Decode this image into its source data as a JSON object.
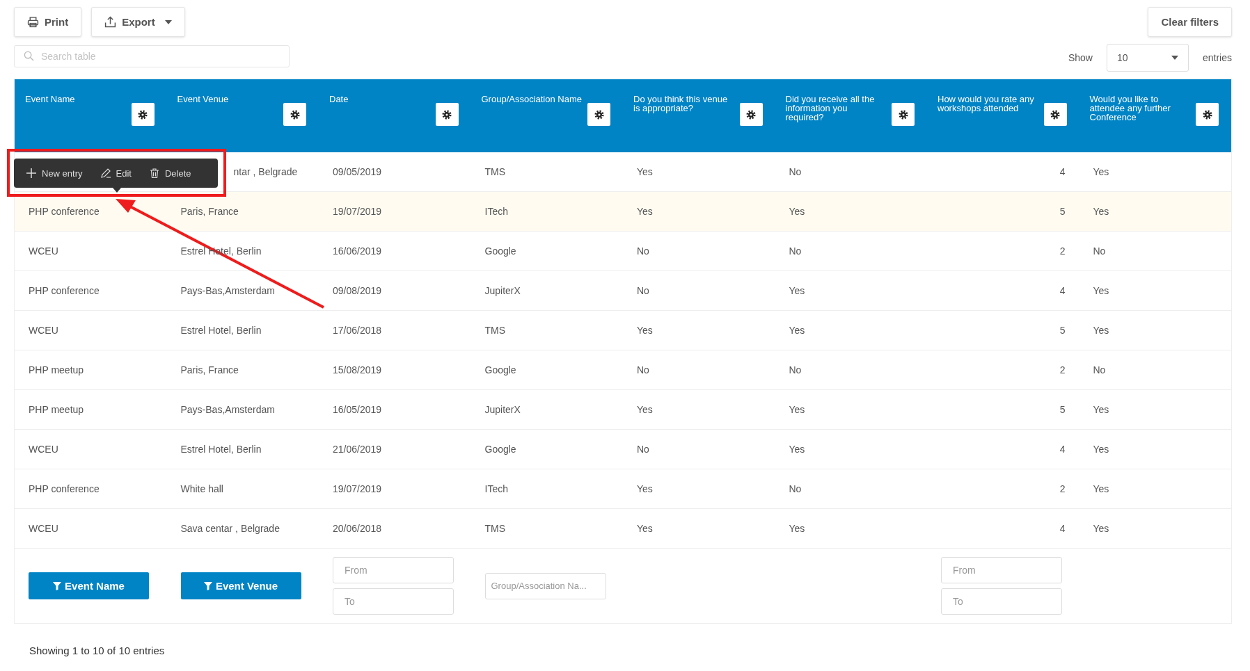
{
  "toolbar": {
    "buttons": [
      {
        "label": "Print",
        "kind": "print"
      },
      {
        "label": "Export",
        "kind": "export"
      }
    ],
    "clear_filters": "Clear filters"
  },
  "search": {
    "placeholder": "Search table"
  },
  "page_size": {
    "label": "Show",
    "value": "10",
    "suffix": "entries"
  },
  "table": {
    "columns": [
      "Event Name",
      "Event Venue",
      "Date",
      "Group/Association Name",
      "Do you think this venue is appropriate?",
      "Did you receive all the information you required?",
      "How would you rate any workshops attended",
      "Would you like to attendee any further Conference"
    ],
    "rows": [
      {
        "venue": "ntar , Belgrade",
        "date": "09/05/2019",
        "group": "TMS",
        "appropriate": "Yes",
        "informed": "No",
        "rating": "4",
        "attend": "Yes",
        "highlighted": false
      },
      {
        "event": "PHP conference",
        "venue": "Paris, France",
        "date": "19/07/2019",
        "group": "ITech",
        "appropriate": "Yes",
        "informed": "Yes",
        "rating": "5",
        "attend": "Yes",
        "highlighted": true
      },
      {
        "event": "WCEU",
        "venue": "Estrel Hotel, Berlin",
        "date": "16/06/2019",
        "group": "Google",
        "appropriate": "No",
        "informed": "No",
        "rating": "2",
        "attend": "No",
        "highlighted": false
      },
      {
        "event": "PHP conference",
        "venue": "Pays-Bas,Amsterdam",
        "date": "09/08/2019",
        "group": "JupiterX",
        "appropriate": "No",
        "informed": "Yes",
        "rating": "4",
        "attend": "Yes",
        "highlighted": false
      },
      {
        "event": "WCEU",
        "venue": "Estrel Hotel, Berlin",
        "date": "17/06/2018",
        "group": "TMS",
        "appropriate": "Yes",
        "informed": "Yes",
        "rating": "5",
        "attend": "Yes",
        "highlighted": false
      },
      {
        "event": "PHP meetup",
        "venue": "Paris, France",
        "date": "15/08/2019",
        "group": "Google",
        "appropriate": "No",
        "informed": "No",
        "rating": "2",
        "attend": "No",
        "highlighted": false
      },
      {
        "event": "PHP meetup",
        "venue": "Pays-Bas,Amsterdam",
        "date": "16/05/2019",
        "group": "JupiterX",
        "appropriate": "Yes",
        "informed": "Yes",
        "rating": "5",
        "attend": "Yes",
        "highlighted": false
      },
      {
        "event": "WCEU",
        "venue": "Estrel Hotel, Berlin",
        "date": "21/06/2019",
        "group": "Google",
        "appropriate": "No",
        "informed": "Yes",
        "rating": "4",
        "attend": "Yes",
        "highlighted": false
      },
      {
        "event": "PHP conference",
        "venue": "White hall",
        "date": "19/07/2019",
        "group": "ITech",
        "appropriate": "Yes",
        "informed": "No",
        "rating": "2",
        "attend": "Yes",
        "highlighted": false
      },
      {
        "event": "WCEU",
        "venue": "Sava centar , Belgrade",
        "date": "20/06/2018",
        "group": "TMS",
        "appropriate": "Yes",
        "informed": "Yes",
        "rating": "4",
        "attend": "Yes",
        "highlighted": false
      }
    ]
  },
  "filters": [
    {
      "kind": "button",
      "label": "Event Name"
    },
    {
      "kind": "button",
      "label": "Event Venue"
    },
    {
      "kind": "range",
      "placeholder_from": "From",
      "placeholder_to": "To"
    },
    {
      "kind": "text",
      "placeholder": "Group/Association Na..."
    },
    {
      "kind": "none"
    },
    {
      "kind": "none"
    },
    {
      "kind": "range",
      "placeholder_from": "From",
      "placeholder_to": "To"
    },
    {
      "kind": "none"
    }
  ],
  "context_menu": {
    "items": [
      {
        "label": "New entry",
        "kind": "add"
      },
      {
        "label": "Edit",
        "kind": "edit"
      },
      {
        "label": "Delete",
        "kind": "delete"
      }
    ]
  },
  "info": "Showing 1 to 10 of 10 entries"
}
